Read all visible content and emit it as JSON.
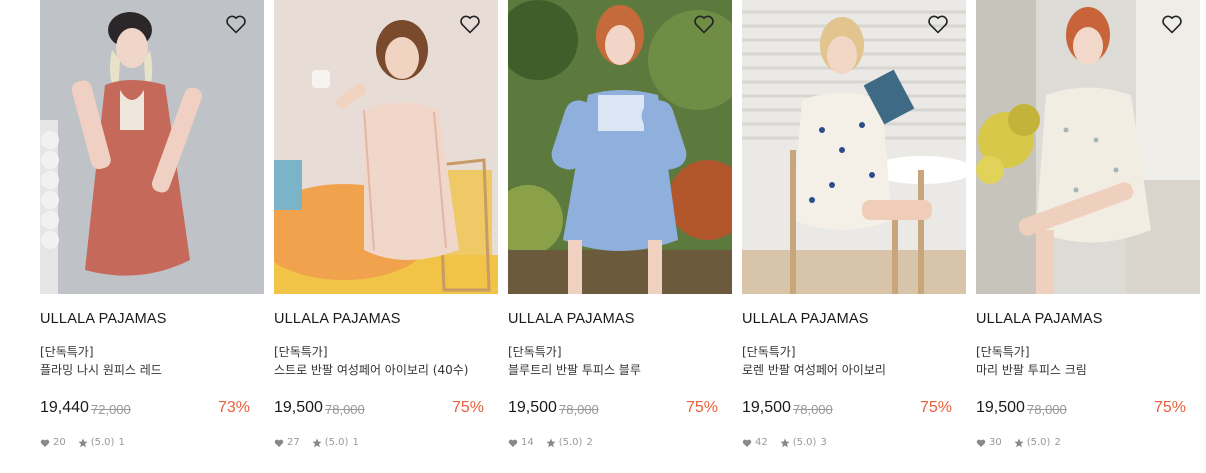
{
  "products": [
    {
      "brand": "ULLALA PAJAMAS",
      "tag": "[단독특가]",
      "name": "플라밍 나시 원피스 레드",
      "price": "19,440",
      "original_price": "72,000",
      "discount": "73%",
      "likes": "20",
      "rating": "(5.0)",
      "reviews": "1"
    },
    {
      "brand": "ULLALA PAJAMAS",
      "tag": "[단독특가]",
      "name": "스트로 반팔 여성페어 아이보리 (40수)",
      "price": "19,500",
      "original_price": "78,000",
      "discount": "75%",
      "likes": "27",
      "rating": "(5.0)",
      "reviews": "1"
    },
    {
      "brand": "ULLALA PAJAMAS",
      "tag": "[단독특가]",
      "name": "블루트리 반팔 투피스 블루",
      "price": "19,500",
      "original_price": "78,000",
      "discount": "75%",
      "likes": "14",
      "rating": "(5.0)",
      "reviews": "2"
    },
    {
      "brand": "ULLALA PAJAMAS",
      "tag": "[단독특가]",
      "name": "로렌 반팔 여성페어 아이보리",
      "price": "19,500",
      "original_price": "78,000",
      "discount": "75%",
      "likes": "42",
      "rating": "(5.0)",
      "reviews": "3"
    },
    {
      "brand": "ULLALA PAJAMAS",
      "tag": "[단독특가]",
      "name": "마리 반팔 투피스 크림",
      "price": "19,500",
      "original_price": "78,000",
      "discount": "75%",
      "likes": "30",
      "rating": "(5.0)",
      "reviews": "2"
    }
  ],
  "colors": {
    "discount": "#e8603c",
    "muted": "#999999",
    "text": "#1a1a1a"
  },
  "icons": {
    "wishlist": "heart-outline-icon",
    "likes": "heart-icon",
    "rating": "star-icon"
  }
}
